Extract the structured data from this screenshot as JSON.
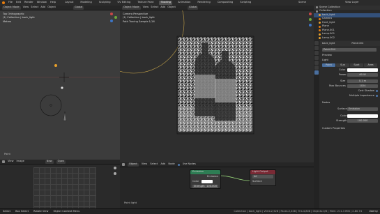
{
  "topbar": {
    "menus": [
      "File",
      "Edit",
      "Render",
      "Window",
      "Help"
    ],
    "tabs": [
      "Layout",
      "Modeling",
      "Sculpting",
      "UV Editing",
      "Texture Paint",
      "Shading",
      "Animation",
      "Rendering",
      "Compositing",
      "Scripting"
    ],
    "active_tab": "Shading",
    "scene": "Scene",
    "view_layer": "View Layer"
  },
  "left_viewport": {
    "mode": "Object Mode",
    "menus": [
      "View",
      "Select",
      "Add",
      "Object"
    ],
    "view": "Global",
    "overlay_lines": [
      "Top Orthographic",
      "(1) Collection | back_light",
      "Meters"
    ],
    "bottom_label": "Paint"
  },
  "camera_viewport": {
    "mode": "Object Mode",
    "menus": [
      "View",
      "Select",
      "Add",
      "Object"
    ],
    "view": "Global",
    "overlay_lines": [
      "Camera Perspective",
      "(1) Collection | back_light",
      "Path Tracing Sample 1/16"
    ]
  },
  "uv_editor": {
    "menus": [
      "View",
      "Image"
    ],
    "new_label": "New",
    "open_label": "Open"
  },
  "node_editor": {
    "menus": [
      "Object",
      "View",
      "Select",
      "Add",
      "Node"
    ],
    "use_nodes": "Use Nodes",
    "footer": "Point light",
    "emission_node": {
      "title": "Emission",
      "out": "Emission",
      "color": "Color",
      "strength_label": "Strength",
      "strength": "100.000"
    },
    "output_node": {
      "title": "Light Output",
      "target": "All",
      "socket": "Surface"
    }
  },
  "outliner": {
    "title": "Scene Collection",
    "items": [
      "Collection",
      "back_light",
      "Camera",
      "front_light",
      "Plane",
      "Plane.001",
      "Lamp.001",
      "Lamp.002"
    ]
  },
  "properties": {
    "object": "back_light",
    "data": "Point.004",
    "preview": "Preview",
    "light_section": "Light",
    "light_types": [
      "Point",
      "Sun",
      "Spot",
      "Area"
    ],
    "color_label": "Color",
    "power_label": "Power",
    "power": "60 W",
    "size_label": "Size",
    "size": "0.1 m",
    "max_bounces_label": "Max Bounces",
    "max_bounces": "1024",
    "cast_shadow": "Cast Shadow",
    "mis": "Multiple Importance",
    "nodes_section": "Nodes",
    "surface_label": "Surface",
    "surface": "Emission",
    "node_color_label": "Color",
    "strength_label": "Strength",
    "strength": "100.000",
    "custom_props": "Custom Properties"
  },
  "status": {
    "left": [
      "Select",
      "Box Select",
      "Rotate View",
      "Object Context Menu"
    ],
    "right": "Collection | back_light | Verts:2,528 | Faces:2,408 | Tris:4,808 | Objects:0/6 | Mem: 211.3 MiB | 2.80.74",
    "watermark": "Udemy"
  },
  "colors": {
    "accent": "#4a6f9e",
    "emission_head": "#2e7d54",
    "output_head": "#7a2a35",
    "active_row": "#33507a"
  }
}
